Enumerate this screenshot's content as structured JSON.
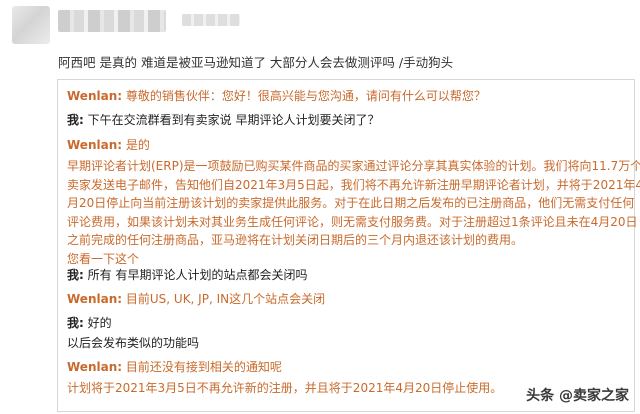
{
  "post": {
    "comment": "阿西吧  是真的  难道是被亚马逊知道了  大部分人会去做测评吗  /手动狗头"
  },
  "chat": {
    "seller_name": "Wenlan:",
    "me_name": "我:",
    "messages": [
      {
        "speaker": "seller",
        "text": "尊敬的销售伙伴：您好！很高兴能与您沟通，请问有什么可以帮您？"
      },
      {
        "speaker": "me",
        "text": "下午在交流群看到有卖家说 早期评论人计划要关闭了？"
      },
      {
        "speaker": "seller",
        "text": "是的"
      },
      {
        "speaker": "seller_paragraph",
        "lines": [
          "早期评论者计划(ERP)是一项鼓励已购买某件商品的买家通过评论分享其真实体验的计划。我们将向11.7万个",
          "卖家发送电子邮件，告知他们自2021年3月5日起，我们将不再允许新注册早期评论者计划，并将于2021年4",
          "月20日停止向当前注册该计划的卖家提供此服务。对于在此日期之后发布的已注册商品，他们无需支付任何",
          "评论费用，如果该计划未对其业务生成任何评论，则无需支付服务费。对于注册超过1条评论且未在4月20日",
          "之前完成的任何注册商品，亚马逊将在计划关闭日期后的三个月内退还该计划的费用。",
          "您看一下这个"
        ]
      },
      {
        "speaker": "me",
        "text": "所有 有早期评论人计划的站点都会关闭吗"
      },
      {
        "speaker": "seller",
        "text": "目前US, UK, JP, IN这几个站点会关闭"
      },
      {
        "speaker": "me",
        "text": "好的"
      },
      {
        "speaker": "me_plain",
        "text": "以后会发布类似的功能吗"
      },
      {
        "speaker": "seller",
        "text": "目前还没有接到相关的通知呢"
      },
      {
        "speaker": "seller_plain",
        "text": "计划将于2021年3月5日不再允许新的注册，并且将于2021年4月20日停止使用。"
      }
    ]
  },
  "watermark": "头条 @卖家之家"
}
